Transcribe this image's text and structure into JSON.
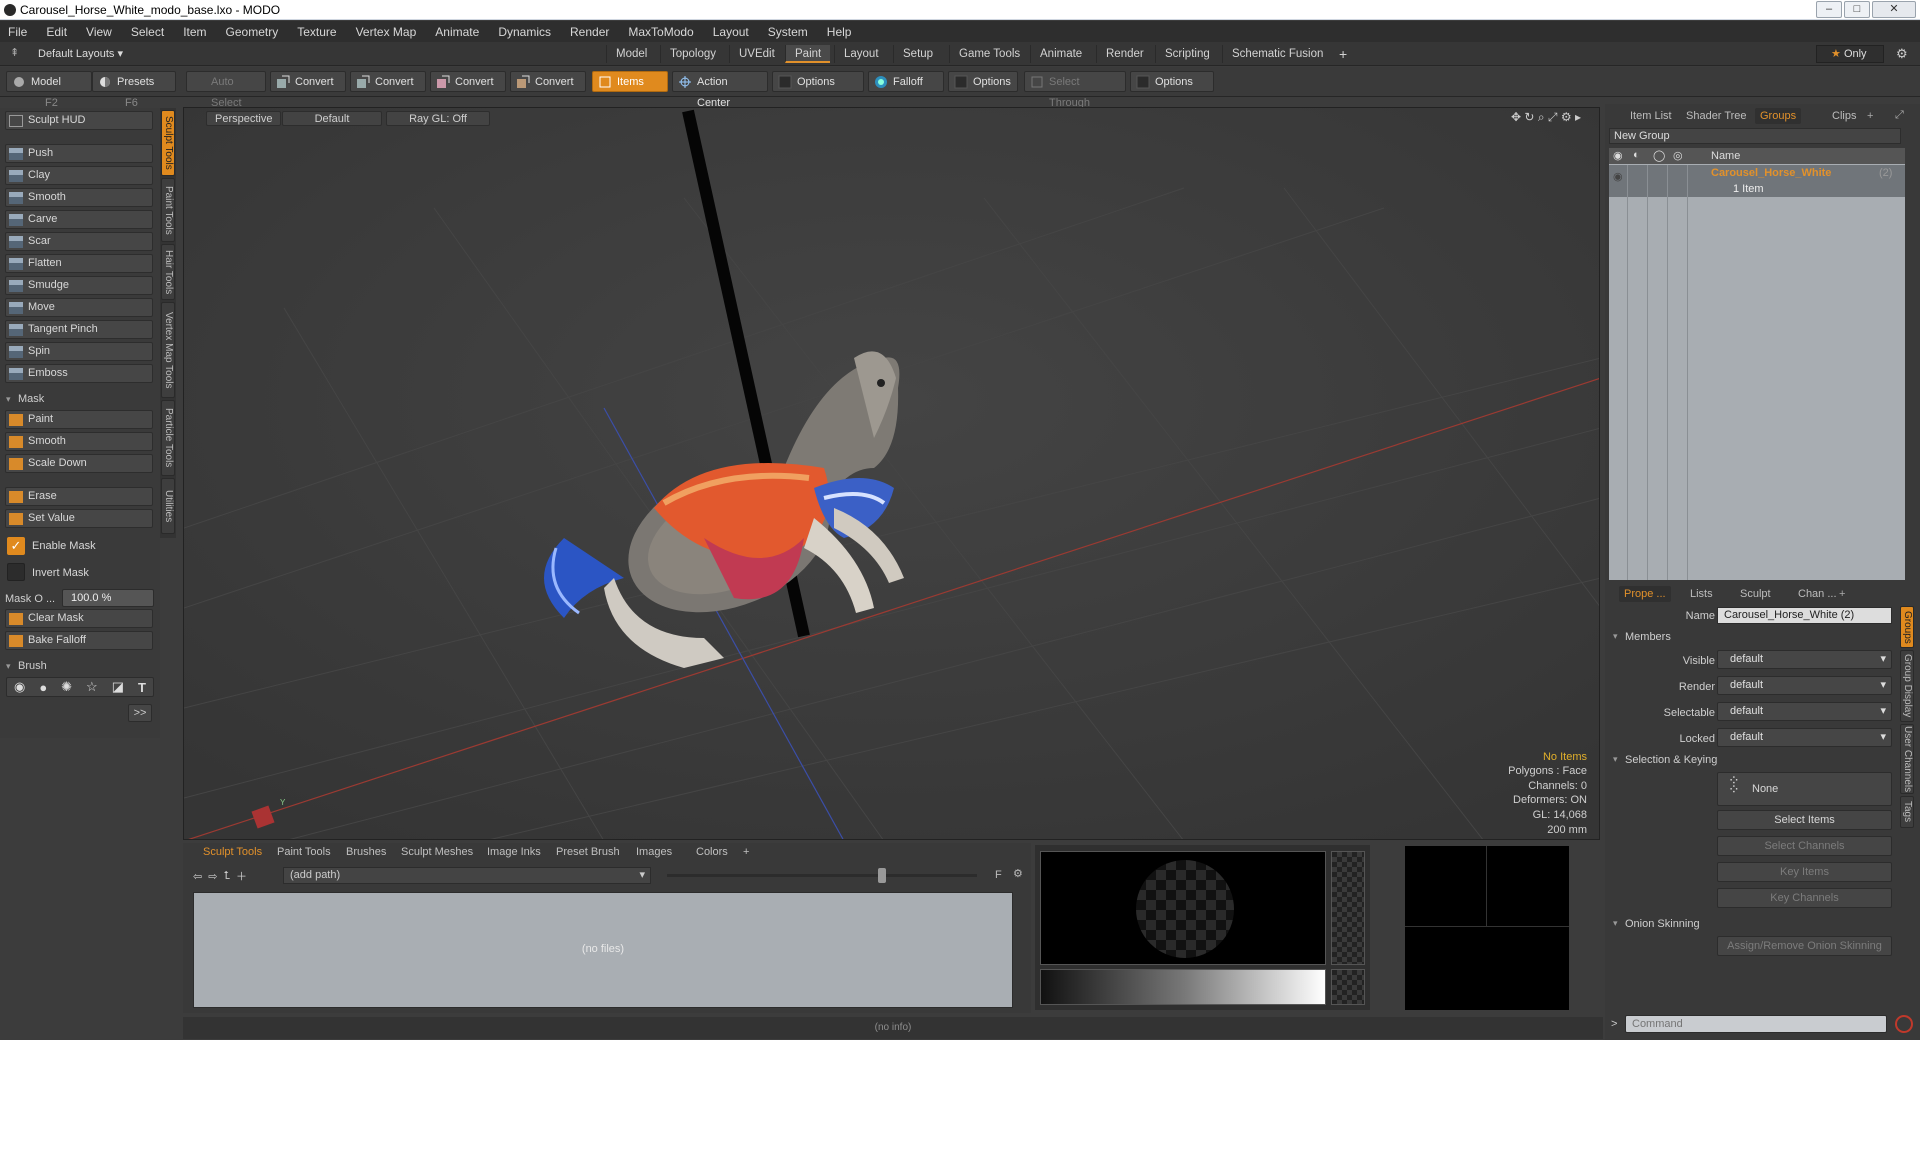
{
  "window": {
    "title": "Carousel_Horse_White_modo_base.lxo - MODO"
  },
  "menu": [
    "File",
    "Edit",
    "View",
    "Select",
    "Item",
    "Geometry",
    "Texture",
    "Vertex Map",
    "Animate",
    "Dynamics",
    "Render",
    "MaxToModo",
    "Layout",
    "System",
    "Help"
  ],
  "layout": {
    "layouts_label": "Default Layouts",
    "tabs": [
      "Model",
      "Topology",
      "UVEdit",
      "Paint",
      "Layout",
      "Setup",
      "Game Tools",
      "Animate",
      "Render",
      "Scripting",
      "Schematic Fusion"
    ],
    "active_tab": "Paint",
    "add": "+",
    "only_label": "Only"
  },
  "toolbar": {
    "model": "Model",
    "model_key": "F2",
    "presets": "Presets",
    "presets_key": "F6",
    "auto_select": "Auto Select",
    "convert1": "Convert",
    "convert2": "Convert",
    "convert3": "Convert",
    "convert4": "Convert",
    "items": "Items",
    "action_center": "Action Center",
    "options1": "Options",
    "falloff": "Falloff",
    "options2": "Options",
    "select_through": "Select Through",
    "options3": "Options"
  },
  "sculpt": {
    "hud": "Sculpt HUD",
    "tools": [
      "Push",
      "Clay",
      "Smooth",
      "Carve",
      "Scar",
      "Flatten",
      "Smudge",
      "Move",
      "Tangent Pinch",
      "Spin",
      "Emboss"
    ],
    "mask_header": "Mask",
    "mask_tools": [
      "Paint",
      "Smooth",
      "Scale Down"
    ],
    "erase": "Erase",
    "set_value": "Set Value",
    "enable_mask": "Enable Mask",
    "invert_mask": "Invert Mask",
    "mask_opacity_label": "Mask O ...",
    "mask_opacity_value": "100.0 %",
    "clear_mask": "Clear Mask",
    "bake_falloff": "Bake Falloff",
    "brush_header": "Brush",
    "more": ">>",
    "vtabs": [
      "Sculpt Tools",
      "Paint Tools",
      "Hair Tools",
      "Vertex Map Tools",
      "Particle Tools",
      "Utilities"
    ]
  },
  "viewport": {
    "view": "Perspective",
    "shading": "Default",
    "raygl": "Ray GL: Off",
    "info": {
      "items": "No Items",
      "polygons": "Polygons : Face",
      "channels": "Channels: 0",
      "deformers": "Deformers: ON",
      "gl": "GL: 14,068",
      "scale": "200 mm"
    }
  },
  "browser": {
    "tabs": [
      "Sculpt Tools",
      "Paint Tools",
      "Brushes",
      "Sculpt Meshes",
      "Image Inks",
      "Preset Brush",
      "Images",
      "Colors"
    ],
    "add": "+",
    "path_placeholder": "(add path)",
    "f_label": "F",
    "empty": "(no files)"
  },
  "status": {
    "info": "(no info)"
  },
  "groups": {
    "tabs": [
      "Item List",
      "Shader Tree",
      "Groups",
      "Clips"
    ],
    "active_tab": "Groups",
    "new_group": "New Group",
    "col_name": "Name",
    "entry_name": "Carousel_Horse_White",
    "entry_count": "(2)",
    "entry_sub": "1 Item"
  },
  "properties": {
    "tabs": [
      "Prope ...",
      "Lists",
      "Sculpt",
      "Chan ..."
    ],
    "active_tab": "Prope ...",
    "name_label": "Name",
    "name_value": "Carousel_Horse_White (2)",
    "members_header": "Members",
    "fields": [
      {
        "label": "Visible",
        "value": "default"
      },
      {
        "label": "Render",
        "value": "default"
      },
      {
        "label": "Selectable",
        "value": "default"
      },
      {
        "label": "Locked",
        "value": "default"
      }
    ],
    "selkey_header": "Selection & Keying",
    "none_label": "None",
    "select_items": "Select Items",
    "select_channels": "Select Channels",
    "key_items": "Key Items",
    "key_channels": "Key Channels",
    "onion_header": "Onion Skinning",
    "onion_button": "Assign/Remove Onion Skinning",
    "side_tabs": [
      "Groups",
      "Group Display",
      "User Channels",
      "Tags"
    ]
  },
  "command": {
    "prompt": ">",
    "placeholder": "Command"
  },
  "colors": {
    "accent": "#e2912b",
    "panel": "#3a3a3a",
    "viewport": "#3b3b3b"
  }
}
